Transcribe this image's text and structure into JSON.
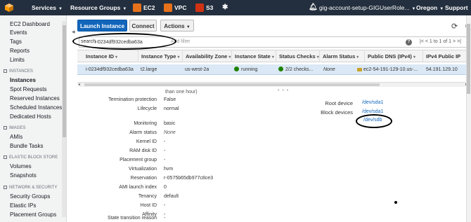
{
  "topnav": {
    "services": "Services",
    "resource_groups": "Resource Groups",
    "ec2": "EC2",
    "vpc": "VPC",
    "s3": "S3",
    "account": "gig-account-setup-GIGUserRole...",
    "region": "Oregon",
    "support": "Support",
    "colors": {
      "bar": "#232f3e",
      "ec2": "#e7711b",
      "vpc": "#e7711b",
      "s3": "#d13212"
    }
  },
  "sidebar": {
    "top_items": [
      "EC2 Dashboard",
      "Events",
      "Tags",
      "Reports",
      "Limits"
    ],
    "sections": [
      {
        "title": "INSTANCES",
        "items": [
          "Instances",
          "Spot Requests",
          "Reserved Instances",
          "Scheduled Instances",
          "Dedicated Hosts"
        ]
      },
      {
        "title": "IMAGES",
        "items": [
          "AMIs",
          "Bundle Tasks"
        ]
      },
      {
        "title": "ELASTIC BLOCK STORE",
        "items": [
          "Volumes",
          "Snapshots"
        ]
      },
      {
        "title": "NETWORK & SECURITY",
        "items": [
          "Security Groups",
          "Elastic IPs",
          "Placement Groups"
        ]
      }
    ],
    "active_item": "Instances"
  },
  "toolbar": {
    "launch": "Launch Instance",
    "connect": "Connect",
    "actions": "Actions"
  },
  "search": {
    "label": "search :",
    "token": "i-0234df932cedba63a",
    "placeholder": "Add filter",
    "pager": "1 to 1 of 1"
  },
  "table": {
    "columns": [
      "Instance ID",
      "Instance Type",
      "Availability Zone",
      "Instance State",
      "Status Checks",
      "Alarm Status",
      "Public DNS (IPv4)",
      "IPv4 Public IP"
    ],
    "row": {
      "instance_id": "i-0234df932cedba63a",
      "instance_type": "t2.large",
      "az": "us-west-2a",
      "state": "running",
      "status_checks": "2/2 checks...",
      "alarm_status": "None",
      "public_dns": "ec2-54-191-129-10.us-...",
      "public_ip": "54.191.129.10"
    }
  },
  "details": {
    "truncated_top": "than one hour)",
    "left": [
      {
        "label": "Termination protection",
        "value": "False"
      },
      {
        "label": "Lifecycle",
        "value": "normal"
      },
      {
        "label": "Monitoring",
        "value": "basic"
      },
      {
        "label": "Alarm status",
        "value": "None"
      },
      {
        "label": "Kernel ID",
        "value": "-"
      },
      {
        "label": "RAM disk ID",
        "value": "-"
      },
      {
        "label": "Placement group",
        "value": "-"
      },
      {
        "label": "Virtualization",
        "value": "hvm"
      },
      {
        "label": "Reservation",
        "value": "r-0575b65db977c8ce3"
      },
      {
        "label": "AMI launch index",
        "value": "0"
      },
      {
        "label": "Tenancy",
        "value": "default"
      },
      {
        "label": "Host ID",
        "value": "-"
      },
      {
        "label": "Affinity",
        "value": "-"
      },
      {
        "label": "State transition reason",
        "value": "-"
      }
    ],
    "right": {
      "root_device_label": "Root device",
      "root_device_value": "/dev/sda1",
      "block_devices_label": "Block devices",
      "block_devices": [
        "/dev/sda1",
        "/dev/sdb"
      ]
    }
  }
}
